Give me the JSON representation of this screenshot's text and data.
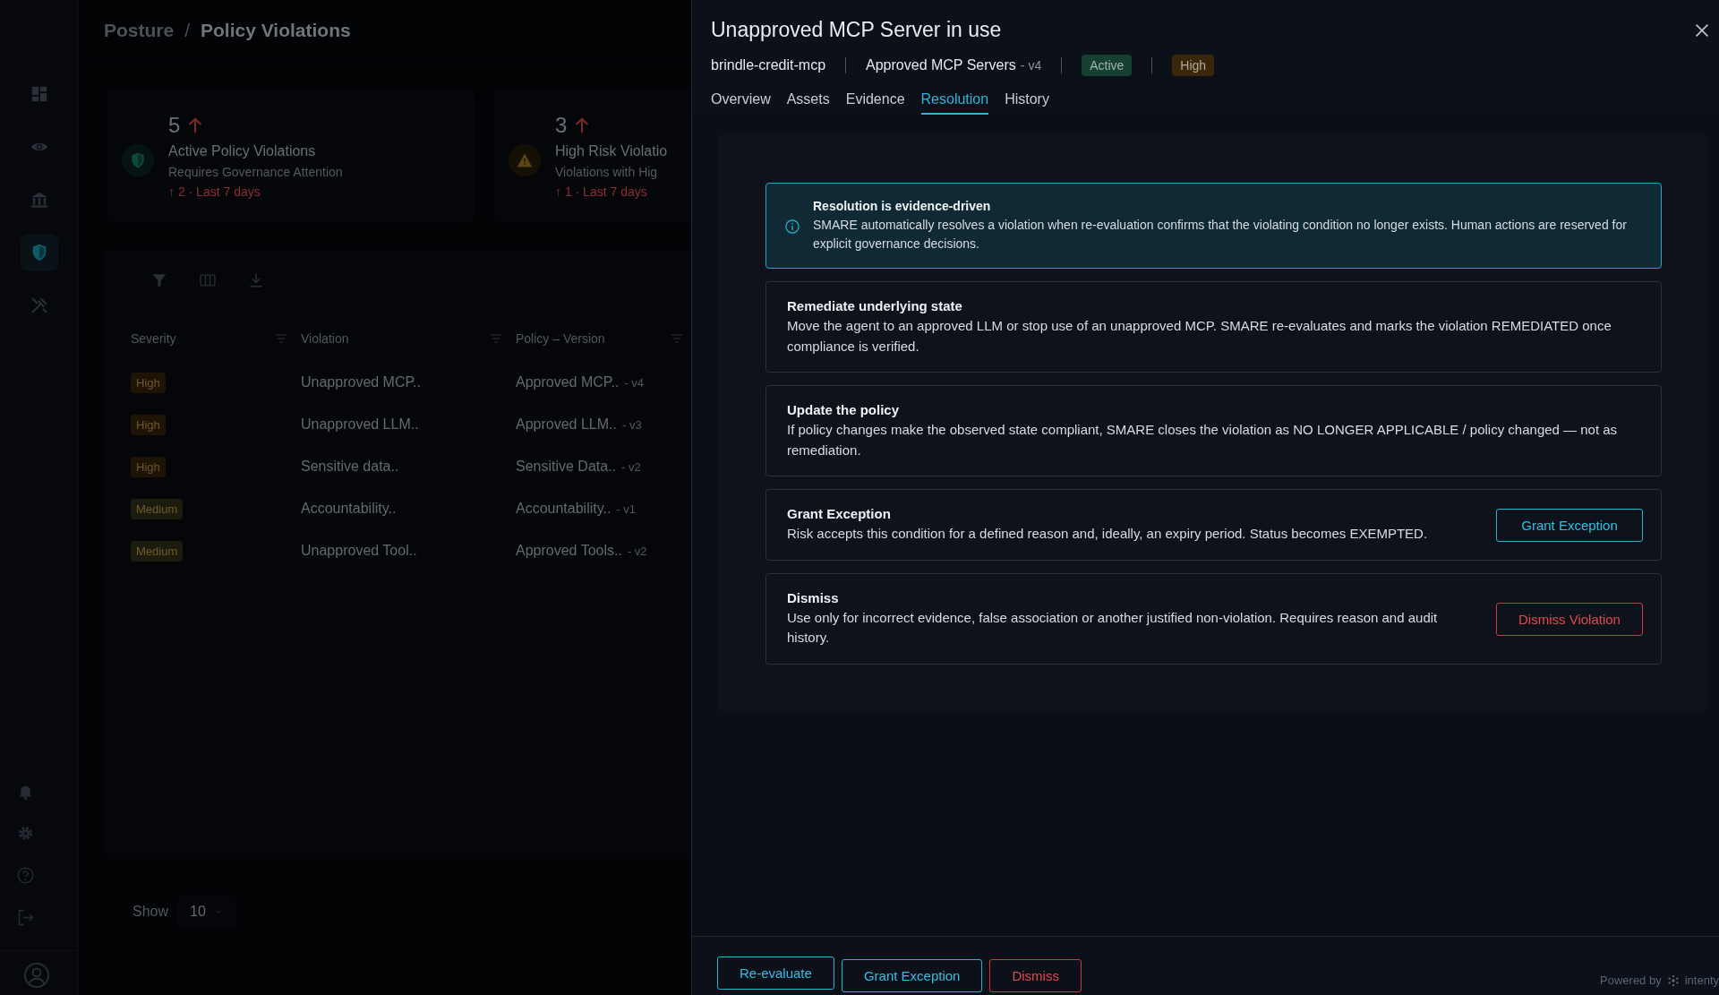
{
  "sidebar": {
    "items": [
      {
        "kind": "dashboard",
        "selected": false
      },
      {
        "kind": "eye",
        "selected": false
      },
      {
        "kind": "bank",
        "selected": false
      },
      {
        "kind": "shield",
        "selected": true
      },
      {
        "kind": "tools",
        "selected": false
      }
    ],
    "bottom_items": [
      {
        "kind": "bell"
      },
      {
        "kind": "gear"
      },
      {
        "kind": "help"
      },
      {
        "kind": "logout"
      }
    ]
  },
  "breadcrumb": {
    "separator": "/",
    "items": [
      {
        "label": "Posture"
      },
      {
        "label": "Policy Violations"
      }
    ]
  },
  "stats": [
    {
      "kind": "shield",
      "value": "5",
      "title": "Active Policy Violations",
      "subtitle": "Requires Governance Attention",
      "trend": "↑ 2 · Last 7 days"
    },
    {
      "kind": "warning",
      "value": "3",
      "title": "High Risk Violatio",
      "subtitle": "Violations with Hig",
      "trend": "↑ 1 · Last 7 days"
    }
  ],
  "table": {
    "columns": [
      "Severity",
      "Violation",
      "Policy – Version"
    ],
    "rows": [
      {
        "severity": "High",
        "color": "#1e1406",
        "violation": "Unapproved MCP..",
        "policy": "Approved MCP..",
        "version": "- v4"
      },
      {
        "severity": "High",
        "color": "#1e1406",
        "violation": "Unapproved LLM..",
        "policy": "Approved LLM..",
        "version": "- v3"
      },
      {
        "severity": "High",
        "color": "#1e1406",
        "violation": "Sensitive data..",
        "policy": "Sensitive Data..",
        "version": "- v2"
      },
      {
        "severity": "Medium",
        "color": "#1c1c0e",
        "violation": "Accountability..",
        "policy": "Accountability..",
        "version": "- v1"
      },
      {
        "severity": "Medium",
        "color": "#1c1c0e",
        "violation": "Unapproved Tool..",
        "policy": "Approved Tools..",
        "version": "- v2"
      }
    ]
  },
  "pagination": {
    "label": "Show",
    "page_size": "10"
  },
  "drawer": {
    "title": "Unapproved MCP Server in use",
    "asset": "brindle-credit-mcp",
    "policy": "Approved MCP Servers",
    "version": "- v4",
    "badges": [
      {
        "label": "Active",
        "color": "#16402f"
      },
      {
        "label": "High",
        "color": "#3a2608"
      }
    ],
    "tabs": [
      {
        "label": "Overview",
        "selected": false
      },
      {
        "label": "Assets",
        "selected": false
      },
      {
        "label": "Evidence",
        "selected": false
      },
      {
        "label": "Resolution",
        "selected": true
      },
      {
        "label": "History",
        "selected": false
      }
    ],
    "cards": [
      {
        "kind": "info",
        "title": "Resolution is evidence-driven",
        "text": "SMARE automatically resolves a violation when re-evaluation confirms that the violating condition no longer exists. Human actions are reserved for explicit governance decisions."
      },
      {
        "kind": "option",
        "title": "Remediate underlying state",
        "text": "Move the agent to an approved LLM or stop use of an unapproved MCP. SMARE re-evaluates and marks the violation REMEDIATED once compliance is verified."
      },
      {
        "kind": "option",
        "title": "Update the policy",
        "text": "If policy changes make the observed state compliant, SMARE closes the violation as NO LONGER APPLICABLE / policy changed — not as remediation."
      },
      {
        "kind": "option",
        "title": "Grant Exception",
        "text": "Risk accepts this condition for a defined reason and, ideally, an expiry period. Status becomes EXEMPTED.",
        "action": {
          "label": "Grant Exception",
          "kind": "primary"
        }
      },
      {
        "kind": "option",
        "title": "Dismiss",
        "text": "Use only for incorrect evidence, false association or another justified non-violation. Requires reason and audit history.",
        "action": {
          "label": "Dismiss Violation",
          "kind": "danger"
        }
      }
    ],
    "footer_buttons": [
      {
        "label": "Re-evaluate",
        "kind": "primary"
      },
      {
        "label": "Grant Exception",
        "kind": "primary"
      },
      {
        "label": "Dismiss",
        "kind": "danger"
      }
    ],
    "powered_by": {
      "label": "Powered by",
      "brand": "intenty"
    }
  }
}
